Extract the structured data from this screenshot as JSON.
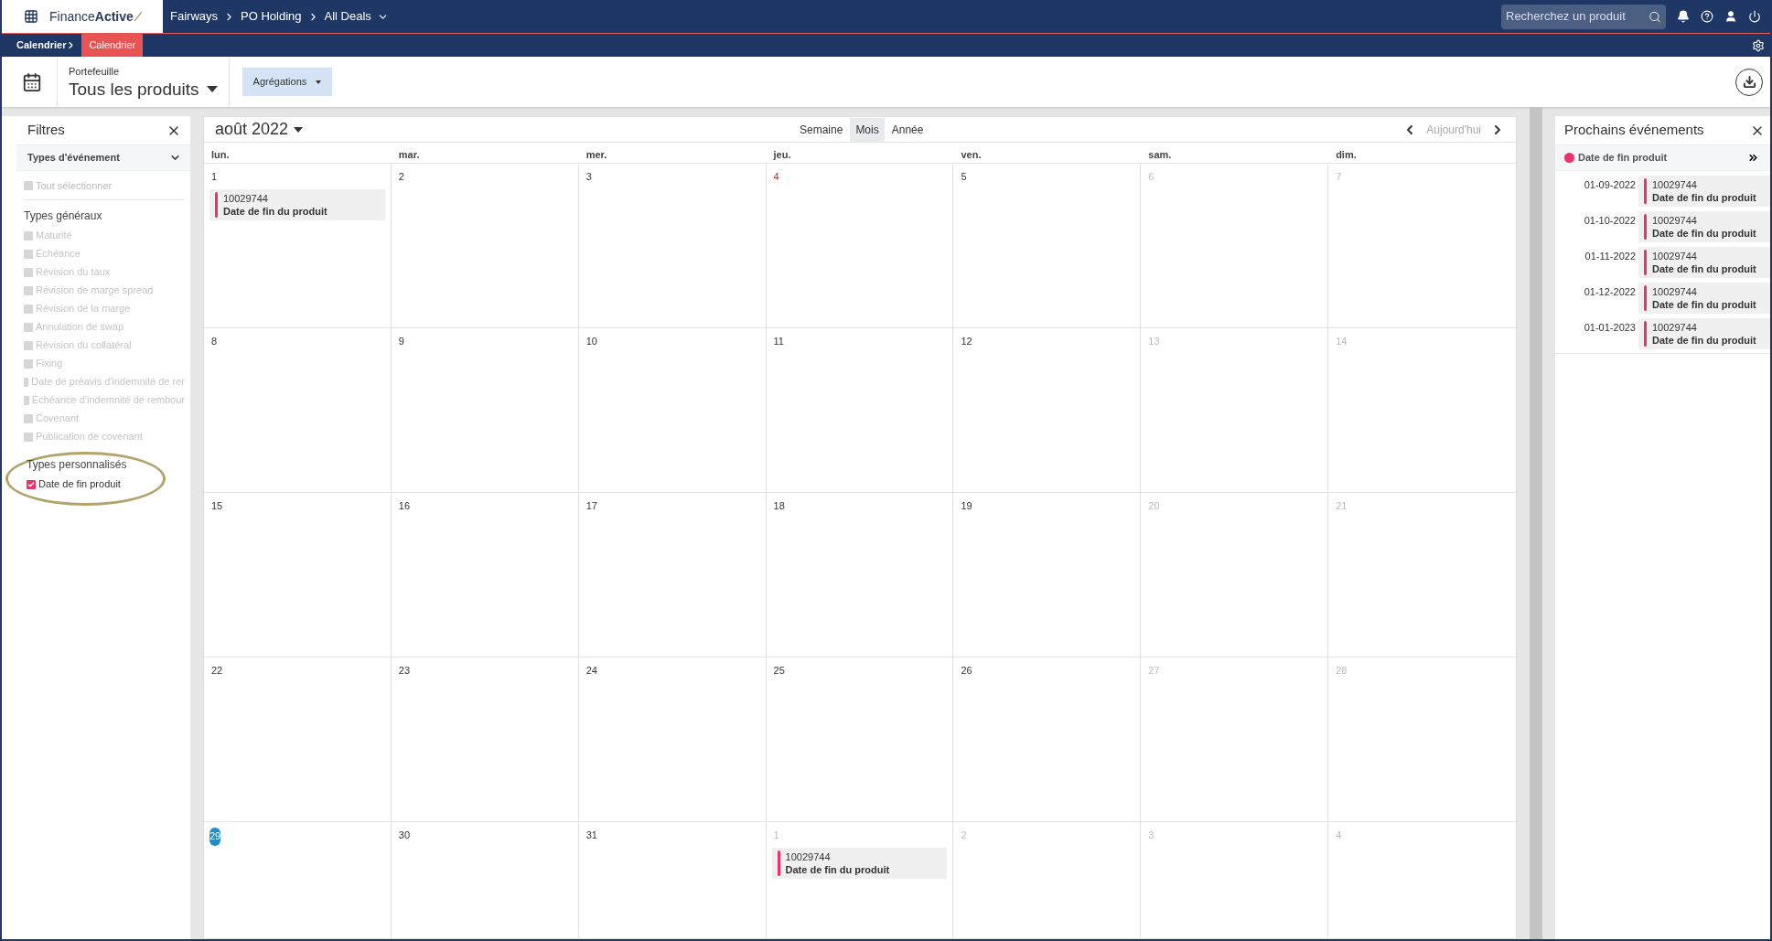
{
  "top_bar": {
    "logo": "Finance**Active**",
    "breadcrumb": [
      "Fairways",
      "PO Holding",
      "All Deals"
    ],
    "search": {
      "placeholder": "Recherchez un produit"
    }
  },
  "sub_bar": {
    "crumb": "Calendrier",
    "tab": "Calendrier"
  },
  "toolbar": {
    "portfolio_label": "Portefeuille",
    "portfolio_value": "Tous les produits",
    "aggregations": "Agrégations"
  },
  "filters": {
    "title": "Filtres",
    "section": "Types d'événement",
    "select_all": {
      "label": "Tout sélectionner",
      "checked": false,
      "disabled": true
    },
    "groups": [
      {
        "title": "Types généraux",
        "items": [
          {
            "label": "Maturité",
            "checked": false,
            "disabled": true
          },
          {
            "label": "Échéance",
            "checked": false,
            "disabled": true
          },
          {
            "label": "Révision du taux",
            "checked": false,
            "disabled": true
          },
          {
            "label": "Révision de marge spread",
            "checked": false,
            "disabled": true
          },
          {
            "label": "Révision de la marge",
            "checked": false,
            "disabled": true
          },
          {
            "label": "Annulation de swap",
            "checked": false,
            "disabled": true
          },
          {
            "label": "Révision du collatéral",
            "checked": false,
            "disabled": true
          },
          {
            "label": "Fixing",
            "checked": false,
            "disabled": true
          },
          {
            "label": "Date de préavis d'indemnité de rer",
            "checked": false,
            "disabled": true
          },
          {
            "label": "Échéance d'indemnité de rembour",
            "checked": false,
            "disabled": true
          },
          {
            "label": "Covenant",
            "checked": false,
            "disabled": true
          },
          {
            "label": "Publication de covenant",
            "checked": false,
            "disabled": true
          }
        ]
      },
      {
        "title": "Types personnalisés",
        "highlighted": true,
        "items": [
          {
            "label": "Date de fin produit",
            "checked": true,
            "disabled": false,
            "color": "#e8336d"
          }
        ]
      }
    ]
  },
  "calendar": {
    "month": "août 2022",
    "views": [
      {
        "label": "Semaine",
        "selected": false
      },
      {
        "label": "Mois",
        "selected": true
      },
      {
        "label": "Année",
        "selected": false
      }
    ],
    "today": {
      "label": "Aujourd'hui",
      "disabled": true
    },
    "weekdays": [
      "lun.",
      "mar.",
      "mer.",
      "jeu.",
      "ven.",
      "sam.",
      "dim."
    ],
    "weeks": [
      [
        {
          "label": "1",
          "kind": "normal",
          "events": [
            {
              "id": "10029744",
              "title": "Date de fin du produit",
              "color": "#e8336d"
            }
          ]
        },
        {
          "label": "2",
          "kind": "normal"
        },
        {
          "label": "3",
          "kind": "normal"
        },
        {
          "label": "4",
          "kind": "holiday"
        },
        {
          "label": "5",
          "kind": "normal"
        },
        {
          "label": "6",
          "kind": "muted"
        },
        {
          "label": "7",
          "kind": "muted"
        }
      ],
      [
        {
          "label": "8",
          "kind": "normal"
        },
        {
          "label": "9",
          "kind": "normal"
        },
        {
          "label": "10",
          "kind": "normal"
        },
        {
          "label": "11",
          "kind": "normal"
        },
        {
          "label": "12",
          "kind": "normal"
        },
        {
          "label": "13",
          "kind": "muted"
        },
        {
          "label": "14",
          "kind": "muted"
        }
      ],
      [
        {
          "label": "15",
          "kind": "normal"
        },
        {
          "label": "16",
          "kind": "normal"
        },
        {
          "label": "17",
          "kind": "normal"
        },
        {
          "label": "18",
          "kind": "normal"
        },
        {
          "label": "19",
          "kind": "normal"
        },
        {
          "label": "20",
          "kind": "muted"
        },
        {
          "label": "21",
          "kind": "muted"
        }
      ],
      [
        {
          "label": "22",
          "kind": "normal"
        },
        {
          "label": "23",
          "kind": "normal"
        },
        {
          "label": "24",
          "kind": "normal"
        },
        {
          "label": "25",
          "kind": "normal"
        },
        {
          "label": "26",
          "kind": "normal"
        },
        {
          "label": "27",
          "kind": "muted"
        },
        {
          "label": "28",
          "kind": "muted"
        }
      ],
      [
        {
          "label": "29",
          "kind": "today"
        },
        {
          "label": "30",
          "kind": "normal"
        },
        {
          "label": "31",
          "kind": "normal"
        },
        {
          "label": "1",
          "kind": "muted",
          "events": [
            {
              "id": "10029744",
              "title": "Date de fin du produit",
              "color": "#e8336d"
            }
          ]
        },
        {
          "label": "2",
          "kind": "muted"
        },
        {
          "label": "3",
          "kind": "muted"
        },
        {
          "label": "4",
          "kind": "muted"
        }
      ]
    ]
  },
  "upcoming": {
    "title": "Prochains événements",
    "legend": {
      "label": "Date de fin produit",
      "color": "#e8336d"
    },
    "events": [
      {
        "date": "01-09-2022",
        "id": "10029744",
        "title": "Date de fin du produit",
        "color": "#e8336d"
      },
      {
        "date": "01-10-2022",
        "id": "10029744",
        "title": "Date de fin du produit",
        "color": "#e8336d"
      },
      {
        "date": "01-11-2022",
        "id": "10029744",
        "title": "Date de fin du produit",
        "color": "#e8336d"
      },
      {
        "date": "01-12-2022",
        "id": "10029744",
        "title": "Date de fin du produit",
        "color": "#e8336d"
      },
      {
        "date": "01-01-2023",
        "id": "10029744",
        "title": "Date de fin du produit",
        "color": "#e8336d"
      }
    ]
  }
}
